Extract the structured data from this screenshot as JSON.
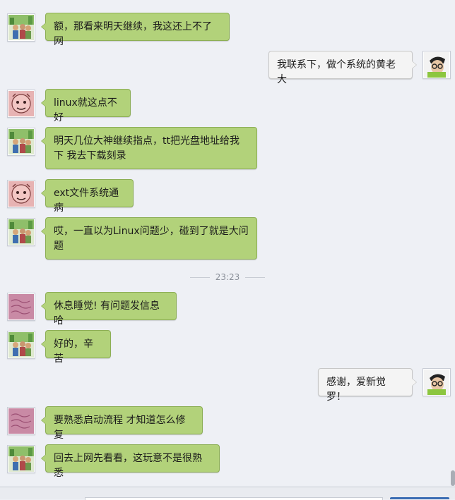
{
  "chat": {
    "time_divider": "23:23",
    "messages": [
      {
        "side": "left",
        "avatar": "avatar-trees-group",
        "text": "额，那看来明天继续，我这还上不了网"
      },
      {
        "side": "right",
        "avatar": "avatar-glasses-man",
        "text": "我联系下，做个系统的黄老大"
      },
      {
        "side": "left",
        "avatar": "avatar-pink-cartoon",
        "text": "linux就这点不好"
      },
      {
        "side": "left",
        "avatar": "avatar-trees-group",
        "text": "明天几位大神继续指点，tt把光盘地址给我下 我去下载刻录"
      },
      {
        "side": "left",
        "avatar": "avatar-pink-cartoon",
        "text": "ext文件系统通病"
      },
      {
        "side": "left",
        "avatar": "avatar-trees-group",
        "text": "哎，一直以为Linux问题少，碰到了就是大问题"
      },
      {
        "side": "left",
        "avatar": "avatar-purple-script",
        "text": "休息睡觉! 有问题发信息哈"
      },
      {
        "side": "left",
        "avatar": "avatar-trees-group",
        "text": "好的，辛苦"
      },
      {
        "side": "right",
        "avatar": "avatar-glasses-man",
        "text": "感谢，爱新觉罗！"
      },
      {
        "side": "left",
        "avatar": "avatar-purple-script",
        "text": "要熟悉启动流程 才知道怎么修复"
      },
      {
        "side": "left",
        "avatar": "avatar-trees-group",
        "text": "回去上网先看看，这玩意不是很熟悉"
      }
    ]
  },
  "colors": {
    "background": "#eef0f5",
    "left_bubble": "#b2d27a",
    "left_bubble_border": "#8cae55",
    "right_bubble": "#f4f4f4",
    "right_bubble_border": "#c7c7c7",
    "time_text": "#8a8f99"
  }
}
